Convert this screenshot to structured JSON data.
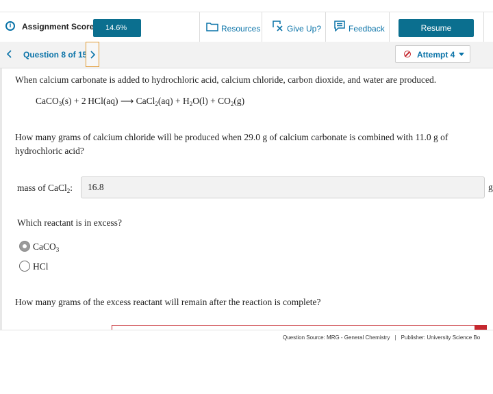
{
  "toolbar": {
    "score_label": "Assignment Score:",
    "score_value": "14.6%",
    "resources_label": "Resources",
    "give_up_label": "Give Up?",
    "feedback_label": "Feedback",
    "resume_label": "Resume"
  },
  "question_nav": {
    "question_label": "Question 8 of 15",
    "attempt_label": "Attempt 4"
  },
  "question": {
    "intro": "When calcium carbonate is added to hydrochloric acid, calcium chloride, carbon dioxide, and water are produced.",
    "prompt_line1": "How many grams of calcium chloride will be produced when 29.0 g of calcium carbonate is combined with 11.0 g of",
    "prompt_line2": "hydrochloric acid?",
    "mass_label_main": "mass of CaCl",
    "mass_label_sub": "2",
    "mass_label_colon": ":",
    "mass_value": "16.8",
    "mass_unit": "g",
    "excess_prompt": "Which reactant is in excess?",
    "options": [
      {
        "label_main": "CaCO",
        "label_sub": "3",
        "selected": true
      },
      {
        "label_main": "HCl",
        "label_sub": "",
        "selected": false
      }
    ],
    "remain_prompt": "How many grams of the excess reactant will remain after the reaction is complete?"
  },
  "footer": {
    "source": "Question Source: MRG - General Chemistry",
    "separator": "|",
    "publisher": "Publisher: University Science Bo"
  },
  "colors": {
    "brand": "#0b6f8f",
    "link": "#0a73a8",
    "focus": "#e29a32",
    "error": "#c5282f"
  }
}
